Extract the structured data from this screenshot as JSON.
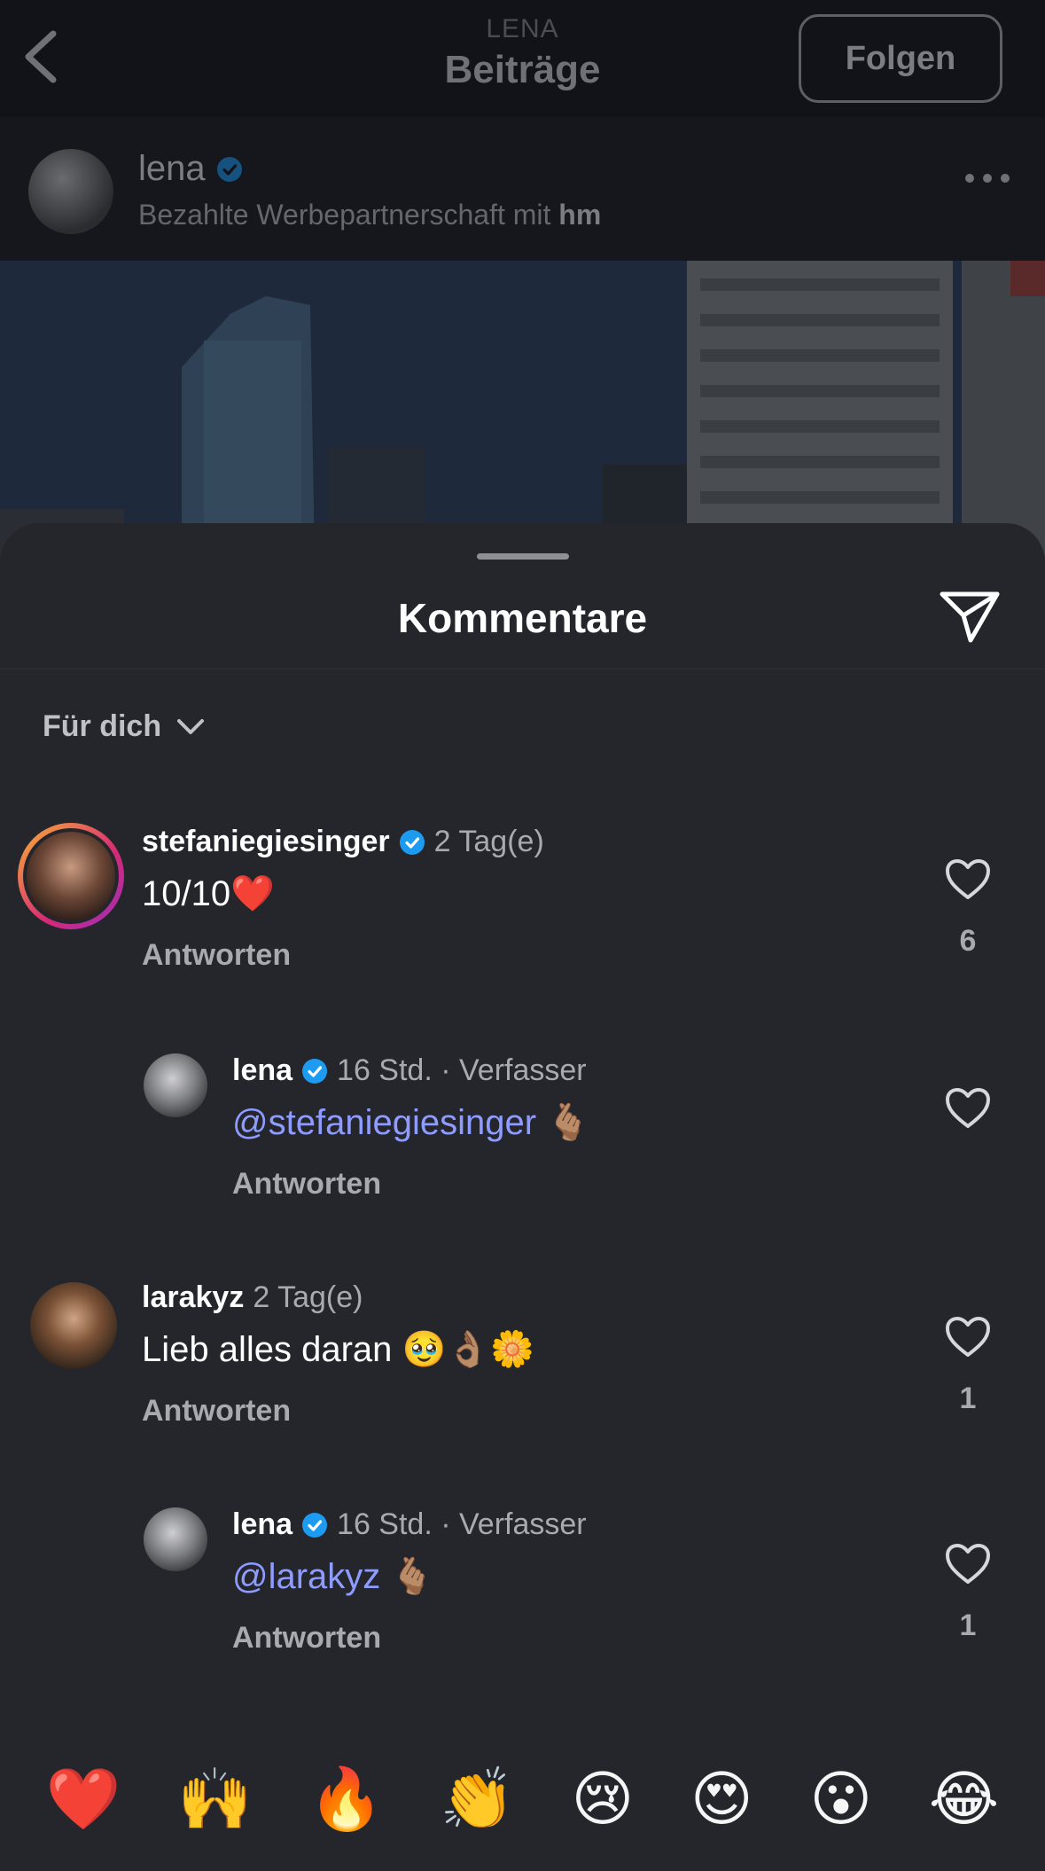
{
  "header": {
    "account_label": "LENA",
    "title": "Beiträge",
    "follow_button": "Folgen"
  },
  "post": {
    "username": "lena",
    "subtitle_prefix": "Bezahlte Werbepartnerschaft mit ",
    "subtitle_partner": "hm"
  },
  "comments_sheet": {
    "title": "Kommentare",
    "filter_label": "Für dich"
  },
  "comments": [
    {
      "username": "stefaniegiesinger",
      "verified": true,
      "time": "2 Tag(e)",
      "text": "10/10❤️",
      "reply_label": "Antworten",
      "likes": "6"
    },
    {
      "username": "lena",
      "verified": true,
      "time": "16 Std. · Verfasser",
      "mention": "@stefaniegiesinger",
      "text_suffix": " 🫰🏽",
      "reply_label": "Antworten",
      "likes": ""
    },
    {
      "username": "larakyz",
      "verified": false,
      "time": "2 Tag(e)",
      "text": "Lieb alles daran 🥹👌🏽🌼",
      "reply_label": "Antworten",
      "likes": "1"
    },
    {
      "username": "lena",
      "verified": true,
      "time": "16 Std. · Verfasser",
      "mention": "@larakyz",
      "text_suffix": " 🫰🏽",
      "reply_label": "Antworten",
      "likes": "1"
    }
  ],
  "reactions": [
    "❤️",
    "🙌",
    "🔥",
    "👏",
    "😢",
    "😍",
    "😮",
    "😂"
  ],
  "colors": {
    "sheet_bg": "#24262c",
    "mention": "#8f9cff",
    "verified": "#1d9bf0",
    "story_ring_start": "#f9b233",
    "story_ring_end": "#d62976"
  }
}
